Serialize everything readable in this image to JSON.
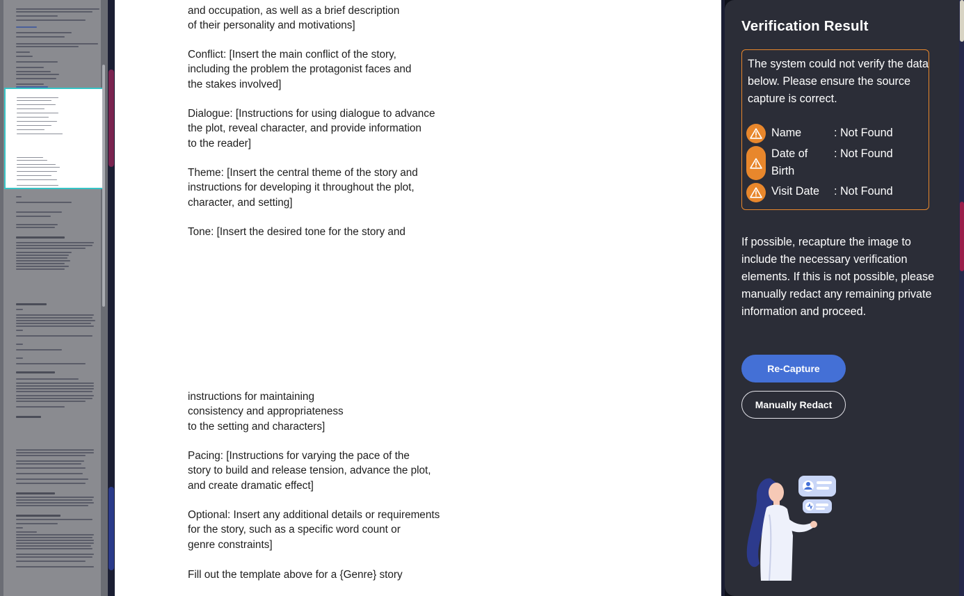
{
  "document": {
    "blocks": [
      "and occupation, as well as a brief description\nof their personality and motivations]",
      "Conflict: [Insert the main conflict of the story,\nincluding the problem the protagonist faces and\nthe stakes involved]",
      "Dialogue: [Instructions for using dialogue to advance\nthe plot, reveal character, and provide information\nto the reader]",
      "Theme: [Insert the central theme of the story and\ninstructions for developing it throughout the plot,\ncharacter, and setting]",
      "Tone: [Insert the desired tone for the story and",
      "instructions for maintaining\nconsistency and appropriateness\nto the setting and characters]",
      "Pacing: [Instructions for varying the pace of the\nstory to build and release tension, advance the plot,\nand create dramatic effect]",
      "Optional: Insert any additional details or requirements\nfor the story, such as a specific word count or\ngenre constraints]",
      "Fill out the template above for a {Genre} story"
    ]
  },
  "panel": {
    "title": "Verification Result",
    "warning_message": "The system could not verify the data below. Please ensure the source capture is correct.",
    "fields": [
      {
        "label": "Name",
        "value": ": Not Found",
        "icon": "alert-triangle-icon"
      },
      {
        "label": "Date of Birth",
        "value": ": Not Found",
        "icon": "alert-triangle-icon"
      },
      {
        "label": "Visit Date",
        "value": ": Not Found",
        "icon": "alert-triangle-icon"
      }
    ],
    "instruction": "If possible, recapture the image to include the necessary verification elements. If this is not possible, please manually redact any remaining private information and proceed.",
    "recapture_label": "Re-Capture",
    "redact_label": "Manually Redact"
  },
  "colors": {
    "accent": "#4470d6",
    "warning": "#e8872c",
    "panel_bg": "#2b2d37",
    "highlight": "#36c4c6"
  }
}
